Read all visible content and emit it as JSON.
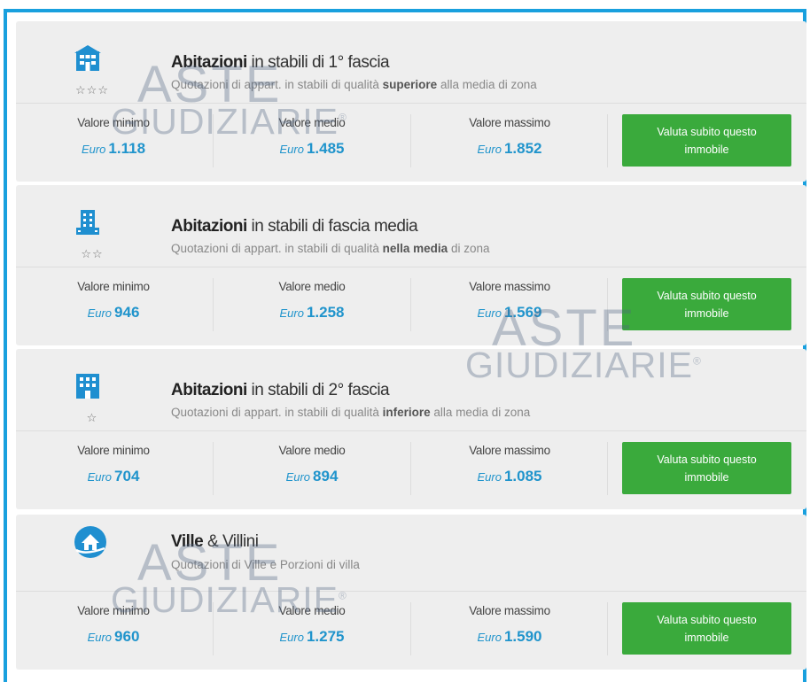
{
  "labels": {
    "min": "Valore minimo",
    "mid": "Valore medio",
    "max": "Valore massimo",
    "currency": "Euro"
  },
  "button_label": "Valuta subito questo immobile",
  "watermark": {
    "line1": "ASTE",
    "line2": "GIUDIZIARIE",
    "mark": "®"
  },
  "cards": [
    {
      "icon": "building-house-icon",
      "stars": "☆☆☆",
      "title_bold": "Abitazioni",
      "title_rest": " in stabili di 1° fascia",
      "sub_pre": "Quotazioni di appart. in stabili di qualità ",
      "sub_bold": "superiore",
      "sub_post": " alla media di zona",
      "min": "1.118",
      "mid": "1.485",
      "max": "1.852"
    },
    {
      "icon": "building-apartment-icon",
      "stars": "☆☆",
      "title_bold": "Abitazioni",
      "title_rest": " in stabili di fascia media",
      "sub_pre": "Quotazioni di appart. in stabili di qualità ",
      "sub_bold": "nella media",
      "sub_post": " di zona",
      "min": "946",
      "mid": "1.258",
      "max": "1.569"
    },
    {
      "icon": "building-office-icon",
      "stars": "☆",
      "title_bold": "Abitazioni",
      "title_rest": " in stabili di 2° fascia",
      "sub_pre": "Quotazioni di appart. in stabili di qualità ",
      "sub_bold": "inferiore",
      "sub_post": " alla media di zona",
      "min": "704",
      "mid": "894",
      "max": "1.085"
    },
    {
      "icon": "villa-hand-icon",
      "stars": "",
      "title_bold": "Ville",
      "title_rest": " & Villini",
      "sub_pre": "Quotazioni di Ville e Porzioni di villa",
      "sub_bold": "",
      "sub_post": "",
      "min": "960",
      "mid": "1.275",
      "max": "1.590"
    }
  ],
  "colors": {
    "accent_blue": "#19a0de",
    "value_blue": "#2094cc",
    "button_green": "#3aaa3c",
    "card_bg": "#eeeeee"
  }
}
